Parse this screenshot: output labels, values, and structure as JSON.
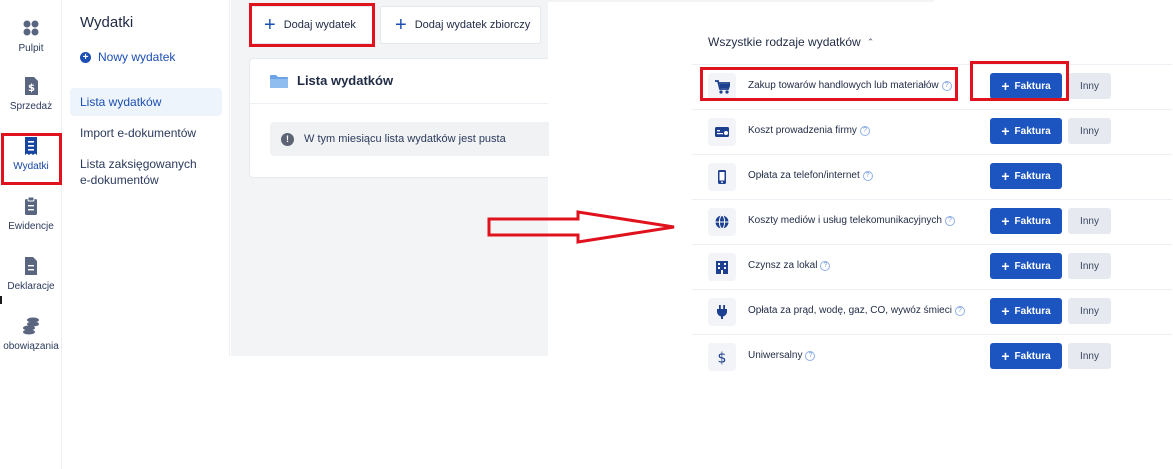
{
  "rail": {
    "items": [
      {
        "label": "Pulpit",
        "icon": "grid-icon"
      },
      {
        "label": "Sprzedaż",
        "icon": "dollar-document-icon"
      },
      {
        "label": "Wydatki",
        "icon": "receipt-icon"
      },
      {
        "label": "Ewidencje",
        "icon": "clipboard-list-icon"
      },
      {
        "label": "Deklaracje",
        "icon": "document-icon"
      },
      {
        "label": "obowiązania",
        "icon": "coins-stack-icon"
      }
    ]
  },
  "submenu": {
    "title": "Wydatki",
    "new_label": "Nowy wydatek",
    "items": [
      {
        "label": "Lista wydatków"
      },
      {
        "label": "Import e-dokumentów"
      },
      {
        "label": "Lista zaksięgowanych e-dokumentów"
      }
    ]
  },
  "toolbar": {
    "add_expense": "Dodaj wydatek",
    "add_bulk_expense": "Dodaj wydatek zbiorczy"
  },
  "list_card": {
    "title": "Lista wydatków",
    "empty_notice": "W tym miesiącu lista wydatków jest pusta"
  },
  "panel": {
    "title": "Wszystkie rodzaje wydatków",
    "faktura_label": "Faktura",
    "inny_label": "Inny",
    "rows": [
      {
        "label": "Zakup towarów handlowych lub materiałów",
        "icon": "cart-icon",
        "has_inny": true
      },
      {
        "label": "Koszt prowadzenia firmy",
        "icon": "card-icon",
        "has_inny": true
      },
      {
        "label": "Opłata za telefon/internet",
        "icon": "phone-icon",
        "has_inny": false
      },
      {
        "label": "Koszty mediów i usług telekomunikacyjnych",
        "icon": "globe-icon",
        "has_inny": true
      },
      {
        "label": "Czynsz za lokal",
        "icon": "building-icon",
        "has_inny": true
      },
      {
        "label": "Opłata za prąd, wodę, gaz, CO, wywóz śmieci",
        "icon": "plug-icon",
        "has_inny": true
      },
      {
        "label": "Uniwersalny",
        "icon": "dollar-icon",
        "has_inny": true
      }
    ]
  },
  "colors": {
    "accent": "#1c55c0",
    "highlight": "#e0121d",
    "icon_blue": "#1c3f8f"
  }
}
